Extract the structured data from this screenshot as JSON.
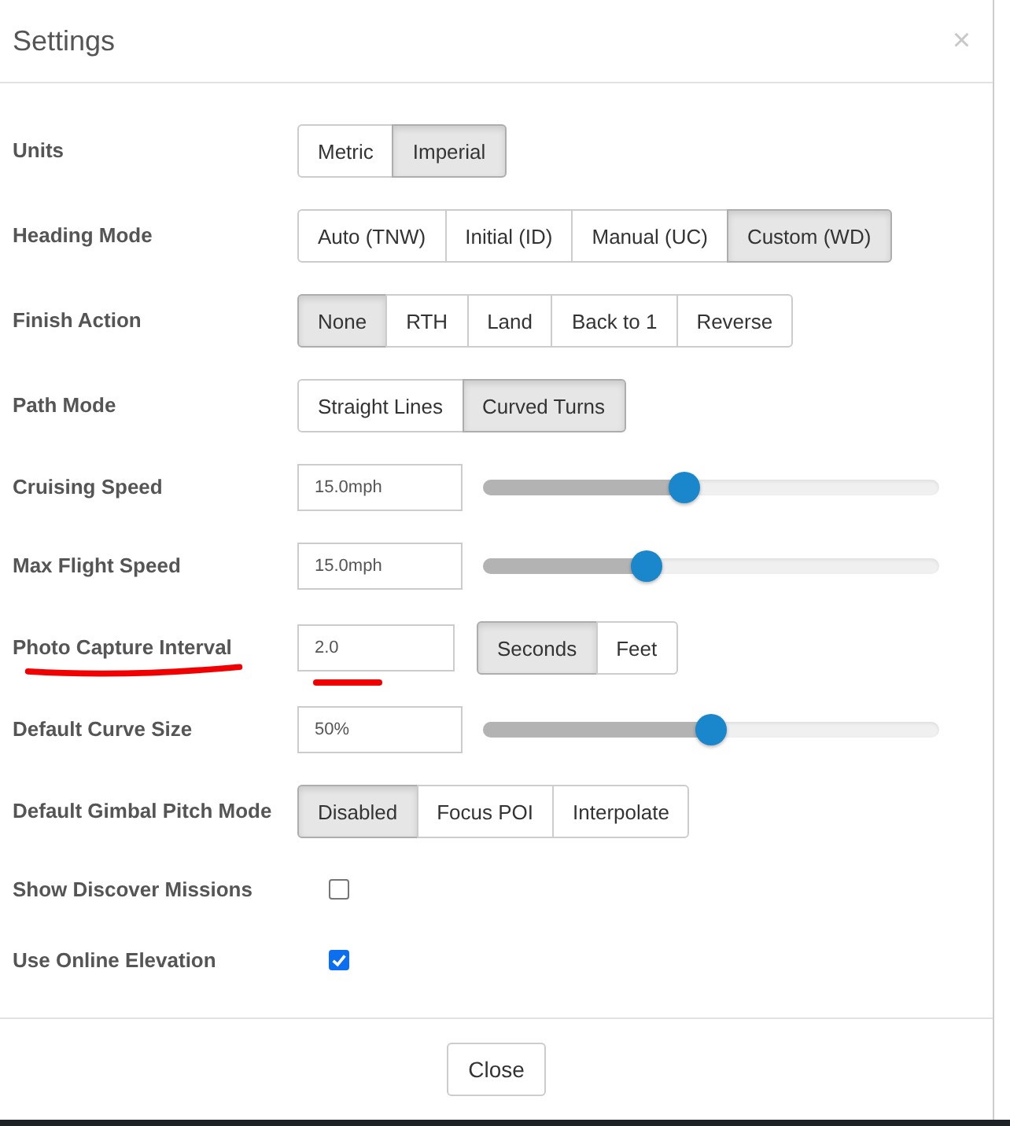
{
  "dialog": {
    "title": "Settings",
    "close_icon": "×"
  },
  "rows": [
    {
      "kind": "segmented",
      "label": "Units",
      "annotated": false,
      "options": [
        {
          "label": "Metric",
          "selected": false
        },
        {
          "label": "Imperial",
          "selected": true
        }
      ]
    },
    {
      "kind": "segmented",
      "label": "Heading Mode",
      "annotated": false,
      "options": [
        {
          "label": "Auto (TNW)",
          "selected": false
        },
        {
          "label": "Initial (ID)",
          "selected": false
        },
        {
          "label": "Manual (UC)",
          "selected": false
        },
        {
          "label": "Custom (WD)",
          "selected": true
        }
      ]
    },
    {
      "kind": "segmented",
      "label": "Finish Action",
      "annotated": false,
      "options": [
        {
          "label": "None",
          "selected": true
        },
        {
          "label": "RTH",
          "selected": false
        },
        {
          "label": "Land",
          "selected": false
        },
        {
          "label": "Back to 1",
          "selected": false
        },
        {
          "label": "Reverse",
          "selected": false
        }
      ]
    },
    {
      "kind": "segmented",
      "label": "Path Mode",
      "annotated": false,
      "options": [
        {
          "label": "Straight Lines",
          "selected": false
        },
        {
          "label": "Curved Turns",
          "selected": true
        }
      ]
    },
    {
      "kind": "slider",
      "label": "Cruising Speed",
      "annotated": false,
      "value": "15.0mph",
      "level": 0.44
    },
    {
      "kind": "slider",
      "label": "Max Flight Speed",
      "annotated": false,
      "value": "15.0mph",
      "level": 0.36
    },
    {
      "kind": "input_segmented",
      "label": "Photo Capture Interval",
      "annotated": true,
      "value": "2.0",
      "options": [
        {
          "label": "Seconds",
          "selected": true
        },
        {
          "label": "Feet",
          "selected": false
        }
      ]
    },
    {
      "kind": "slider",
      "label": "Default Curve Size",
      "annotated": false,
      "value": "50%",
      "level": 0.5
    },
    {
      "kind": "segmented",
      "label": "Default Gimbal Pitch Mode",
      "annotated": false,
      "options": [
        {
          "label": "Disabled",
          "selected": true
        },
        {
          "label": "Focus POI",
          "selected": false
        },
        {
          "label": "Interpolate",
          "selected": false
        }
      ]
    },
    {
      "kind": "checkbox",
      "label": "Show Discover Missions",
      "annotated": false,
      "checked": false
    },
    {
      "kind": "checkbox",
      "label": "Use Online Elevation",
      "annotated": false,
      "checked": true
    }
  ],
  "footer": {
    "button": "Close"
  }
}
